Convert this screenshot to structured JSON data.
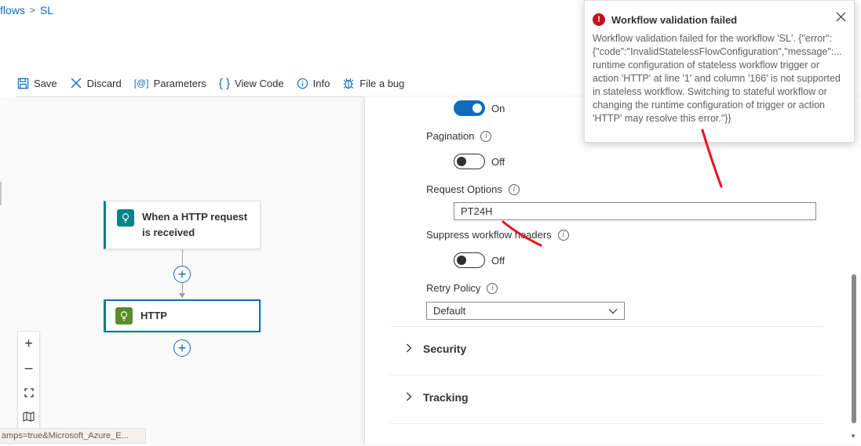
{
  "breadcrumb": {
    "parent": "flows",
    "current": "SL"
  },
  "toolbar": {
    "save": "Save",
    "discard": "Discard",
    "parameters": "Parameters",
    "view_code": "View Code",
    "info": "Info",
    "file_bug": "File a bug"
  },
  "canvas": {
    "trigger_title": "When a HTTP request is received",
    "action_title": "HTTP",
    "status_url": "amps=true&Microsoft_Azure_E..."
  },
  "panel": {
    "first_toggle": {
      "state": "On"
    },
    "pagination": {
      "label": "Pagination",
      "state": "Off"
    },
    "request_options": {
      "label": "Request Options",
      "value": "PT24H"
    },
    "suppress_headers": {
      "label": "Suppress workflow headers",
      "state": "Off"
    },
    "retry_policy": {
      "label": "Retry Policy",
      "value": "Default"
    },
    "sections": [
      "Security",
      "Tracking"
    ]
  },
  "toast": {
    "title": "Workflow validation failed",
    "message": "Workflow validation failed for the workflow 'SL'. {\"error\":{\"code\":\"InvalidStatelessFlowConfiguration\",\"message\":... runtime configuration of stateless workflow trigger or action 'HTTP' at line '1' and column '166' is not supported in stateless workflow. Switching to stateful workflow or changing the runtime configuration of trigger or action 'HTTP' may resolve this error.\"}}"
  },
  "colors": {
    "accent": "#0f6cbd",
    "error": "#c50f1f",
    "trigger": "#038387",
    "annotation": "#e81123"
  },
  "icons": [
    "chevron-right-icon",
    "save-icon",
    "discard-icon",
    "parameters-icon",
    "code-braces-icon",
    "info-icon",
    "bug-icon",
    "request-icon",
    "http-icon",
    "plus-icon",
    "zoom-in-icon",
    "zoom-out-icon",
    "fit-view-icon",
    "minimap-icon",
    "error-icon",
    "close-icon",
    "chevron-down-icon"
  ]
}
